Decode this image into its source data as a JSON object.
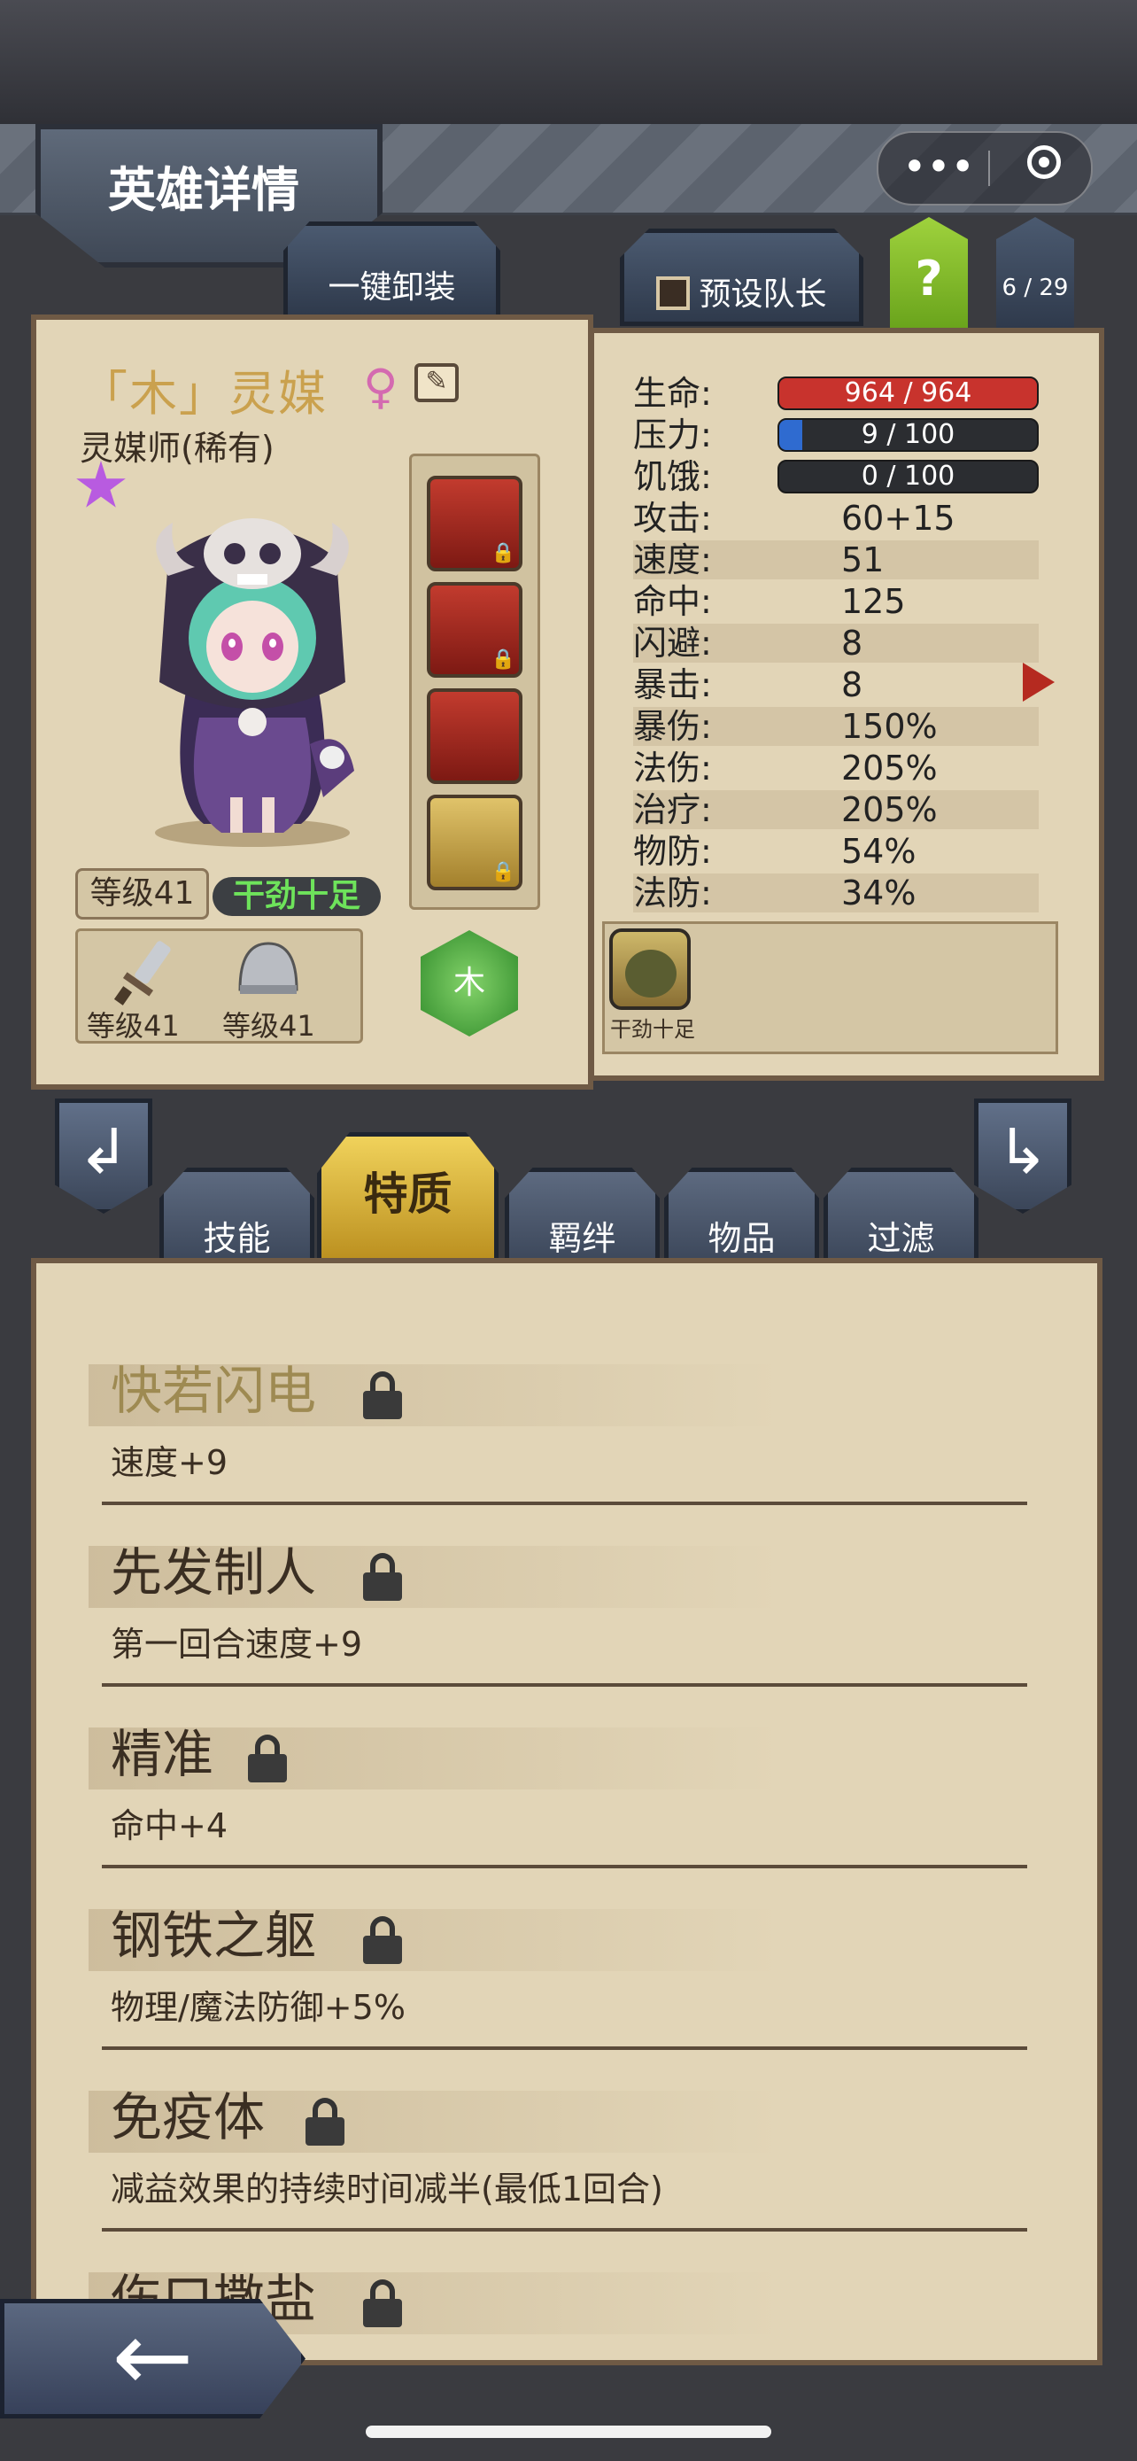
{
  "header": {
    "title": "英雄详情",
    "more_icon": "more-dots-icon",
    "close_icon": "target-circle-icon"
  },
  "top_buttons": {
    "unequip_all": "一键卸装",
    "preset_leader": "预设队长",
    "help": "?",
    "page": "6 / 29"
  },
  "hero": {
    "name": "「木」灵媒",
    "gender_icon": "♀",
    "class": "灵媒师(稀有)",
    "level": "等级41",
    "status": "干劲十足",
    "weapon_level": "等级41",
    "armor_level": "等级41",
    "element": "木"
  },
  "stats": {
    "hp": {
      "label": "生命:",
      "value": "964 / 964",
      "fraction": 1.0,
      "color": "#c8332d"
    },
    "stress": {
      "label": "压力:",
      "value": "9 / 100",
      "fraction": 0.09,
      "color": "#2f6bd0"
    },
    "hunger": {
      "label": "饥饿:",
      "value": "0 / 100",
      "fraction": 0.0,
      "color": "#888888"
    },
    "rows": [
      {
        "label": "攻击:",
        "value": "60+15"
      },
      {
        "label": "速度:",
        "value": "51"
      },
      {
        "label": "命中:",
        "value": "125"
      },
      {
        "label": "闪避:",
        "value": "8"
      },
      {
        "label": "暴击:",
        "value": "8"
      },
      {
        "label": "暴伤:",
        "value": "150%"
      },
      {
        "label": "法伤:",
        "value": "205%"
      },
      {
        "label": "治疗:",
        "value": "205%"
      },
      {
        "label": "物防:",
        "value": "54%"
      },
      {
        "label": "法防:",
        "value": "34%"
      }
    ]
  },
  "trait_badge": {
    "name": "干劲十足"
  },
  "tabs": [
    "技能",
    "特质",
    "羁绊",
    "物品",
    "过滤"
  ],
  "active_tab": "特质",
  "traits": [
    {
      "name": "快若闪电",
      "desc": "速度+9"
    },
    {
      "name": "先发制人",
      "desc": "第一回合速度+9"
    },
    {
      "name": "精准",
      "desc": "命中+4"
    },
    {
      "name": "钢铁之躯",
      "desc": "物理/魔法防御+5%"
    },
    {
      "name": "免疫体",
      "desc": "减益效果的持续时间减半(最低1回合)"
    },
    {
      "name": "伤口撒盐",
      "desc": ""
    }
  ]
}
